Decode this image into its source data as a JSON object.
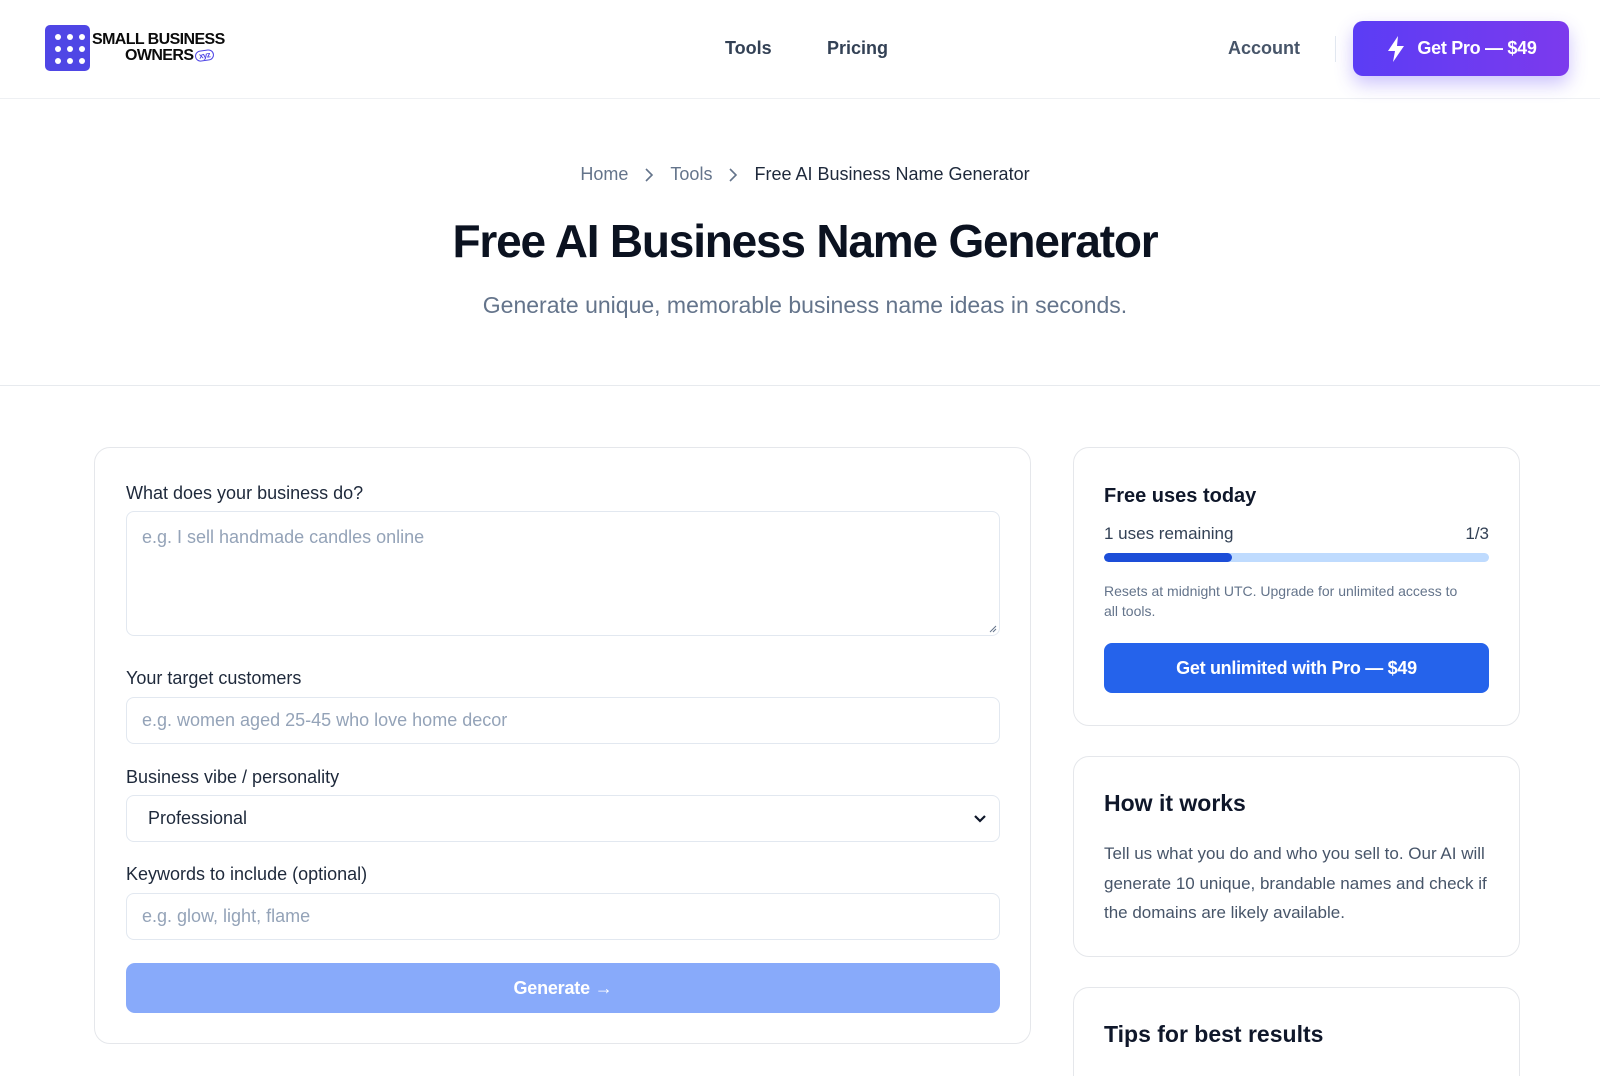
{
  "brand": {
    "line1": "SMALL BUSINESS",
    "line2": "OWNERS",
    "badge": "xyz",
    "accent": "#4f46e5"
  },
  "nav": {
    "tools": "Tools",
    "pricing": "Pricing",
    "account": "Account",
    "get_pro": "Get Pro — $49"
  },
  "breadcrumb": {
    "home": "Home",
    "tools": "Tools",
    "current": "Free AI Business Name Generator"
  },
  "hero": {
    "title": "Free AI Business Name Generator",
    "subtitle": "Generate unique, memorable business name ideas in seconds."
  },
  "form": {
    "business_label": "What does your business do?",
    "business_placeholder": "e.g. I sell handmade candles online",
    "customers_label": "Your target customers",
    "customers_placeholder": "e.g. women aged 25-45 who love home decor",
    "vibe_label": "Business vibe / personality",
    "vibe_value": "Professional",
    "keywords_label": "Keywords to include (optional)",
    "keywords_placeholder": "e.g. glow, light, flame",
    "generate": "Generate →"
  },
  "usage": {
    "title": "Free uses today",
    "remaining": "1 uses remaining",
    "count": "1/3",
    "fraction": 0.333,
    "note": "Resets at midnight UTC. Upgrade for unlimited access to all tools.",
    "cta": "Get unlimited with Pro — $49"
  },
  "how": {
    "title": "How it works",
    "text": "Tell us what you do and who you sell to. Our AI will generate 10 unique, brandable names and check if the domains are likely available."
  },
  "tips": {
    "title": "Tips for best results"
  },
  "colors": {
    "primary_button": "#2563eb",
    "pro_gradient_start": "#5b3df5",
    "pro_gradient_end": "#7c3aed",
    "generate_disabled": "#88aafa",
    "progress_fill": "#1d4ed8",
    "progress_track": "#bfdbfe"
  },
  "icons": {
    "logo": "grid-dots-icon",
    "get_pro": "bolt-icon",
    "breadcrumb_separator": "chevron-right-icon",
    "select": "chevron-down-icon"
  }
}
